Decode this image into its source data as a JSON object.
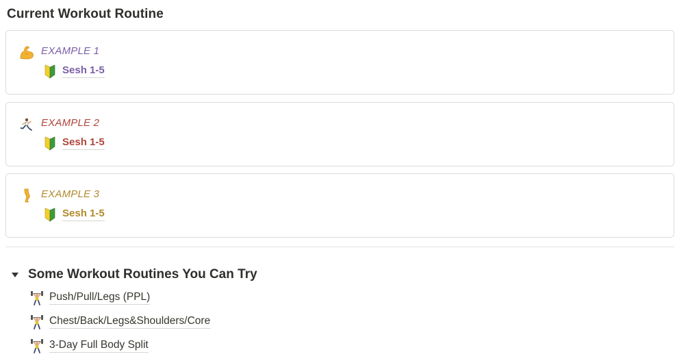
{
  "page": {
    "title": "Current Workout Routine"
  },
  "current_routines": [
    {
      "title": "EXAMPLE 1",
      "icon": "flexed-biceps-icon",
      "link_icon": "beginner-symbol-icon",
      "link_label": "Sesh 1-5",
      "color": "#7b5ea7"
    },
    {
      "title": "EXAMPLE 2",
      "icon": "running-person-icon",
      "link_icon": "beginner-symbol-icon",
      "link_label": "Sesh 1-5",
      "color": "#b0463c"
    },
    {
      "title": "EXAMPLE 3",
      "icon": "leg-icon",
      "link_icon": "beginner-symbol-icon",
      "link_label": "Sesh 1-5",
      "color": "#b08a2c"
    }
  ],
  "suggestions": {
    "title": "Some Workout Routines You Can Try",
    "toggle_icon": "triangle-down-icon",
    "items": [
      {
        "label": "Push/Pull/Legs (PPL)",
        "icon": "weight-lifter-icon"
      },
      {
        "label": "Chest/Back/Legs&Shoulders/Core",
        "icon": "weight-lifter-icon"
      },
      {
        "label": "3-Day Full Body Split",
        "icon": "weight-lifter-icon"
      }
    ]
  }
}
